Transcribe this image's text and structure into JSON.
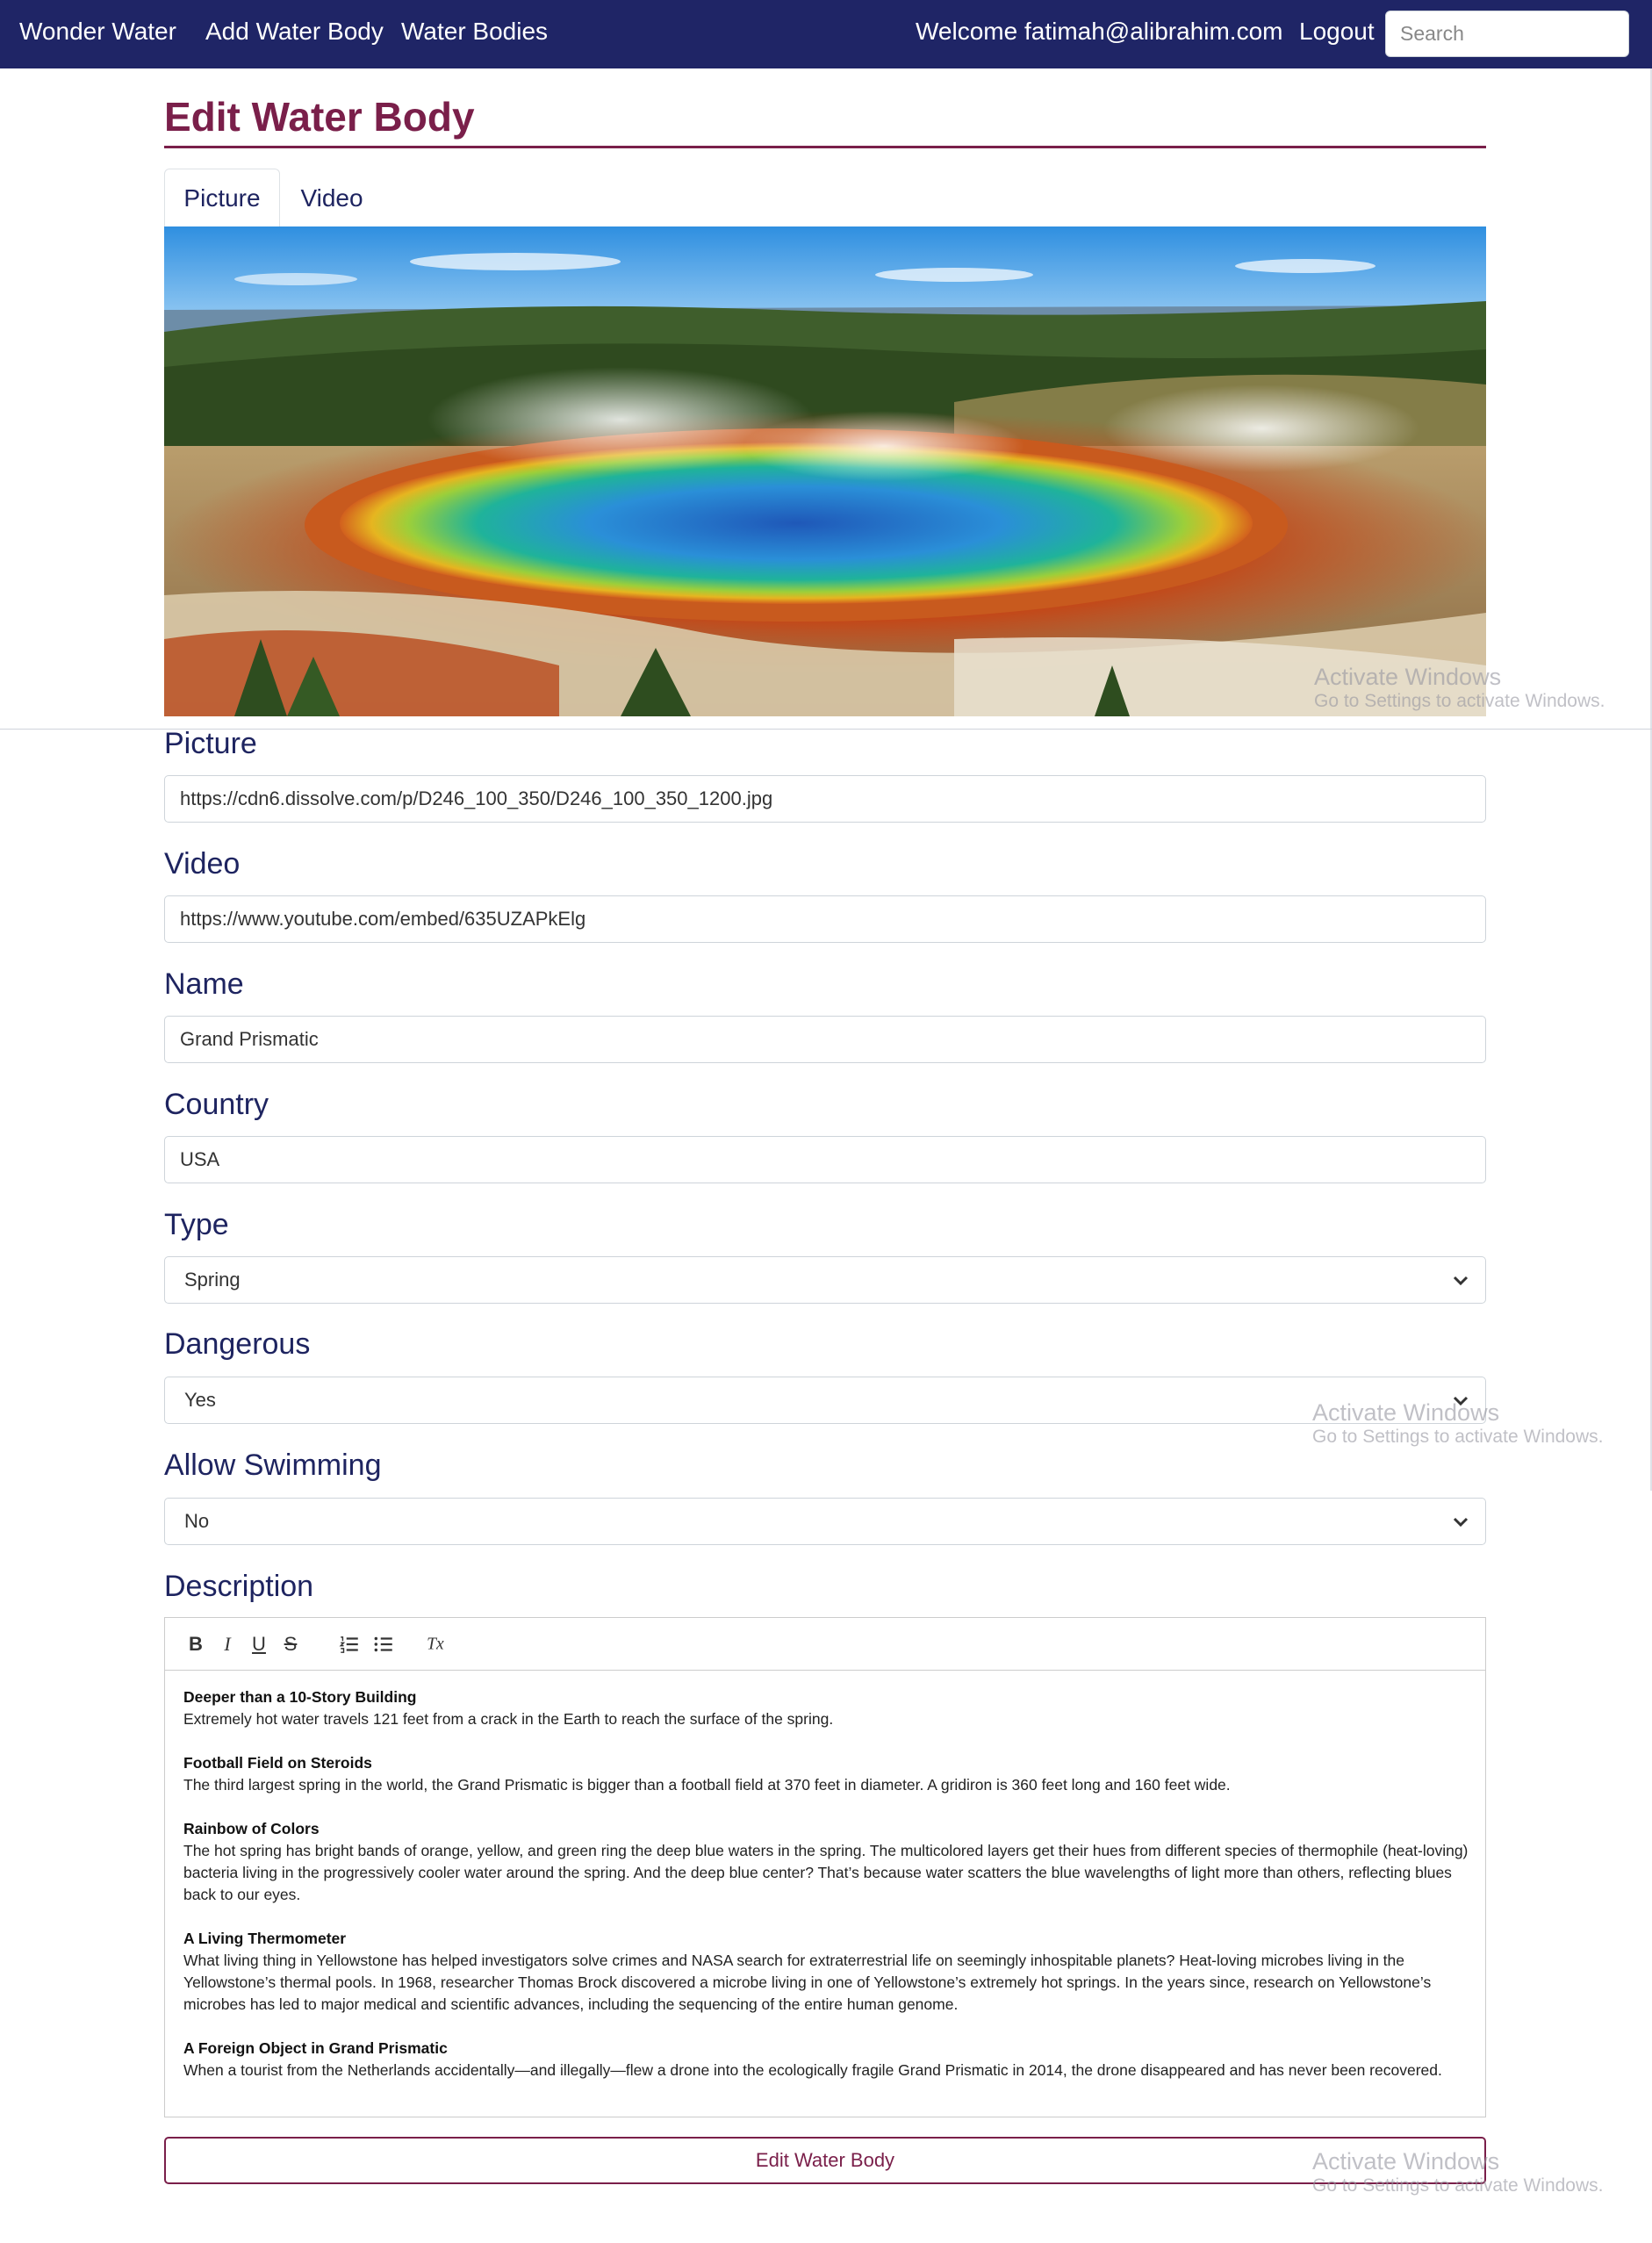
{
  "navbar": {
    "brand": "Wonder Water",
    "add_link": "Add Water Body",
    "list_link": "Water Bodies",
    "welcome": "Welcome fatimah@alibrahim.com",
    "logout": "Logout",
    "search_placeholder": "Search"
  },
  "page": {
    "title": "Edit Water Body"
  },
  "tabs": [
    {
      "label": "Picture",
      "active": true
    },
    {
      "label": "Video",
      "active": false
    }
  ],
  "form": {
    "picture": {
      "label": "Picture",
      "value": "https://cdn6.dissolve.com/p/D246_100_350/D246_100_350_1200.jpg"
    },
    "video": {
      "label": "Video",
      "value": "https://www.youtube.com/embed/635UZAPkElg"
    },
    "name": {
      "label": "Name",
      "value": "Grand Prismatic"
    },
    "country": {
      "label": "Country",
      "value": "USA"
    },
    "type": {
      "label": "Type",
      "value": "Spring"
    },
    "dangerous": {
      "label": "Dangerous",
      "value": "Yes"
    },
    "allow_swimming": {
      "label": "Allow Swimming",
      "value": "No"
    },
    "description": {
      "label": "Description",
      "toolbar": {
        "bold": "B",
        "italic": "I",
        "underline": "U",
        "strike": "S",
        "clear": "Tx"
      },
      "sections": [
        {
          "heading": "Deeper than a 10-Story Building",
          "body": "Extremely hot water travels 121 feet from a crack in the Earth to reach the surface of the spring."
        },
        {
          "heading": "Football Field on Steroids",
          "body": "The third largest spring in the world, the Grand Prismatic is bigger than a football field at 370 feet in diameter. A gridiron is 360 feet long and 160 feet wide."
        },
        {
          "heading": "Rainbow of Colors",
          "body": "The hot spring has bright bands of orange, yellow, and green ring the deep blue waters in the spring. The multicolored layers get their hues from different species of thermophile (heat-loving) bacteria living in the progressively cooler water around the spring. And the deep blue center? That’s because water scatters the blue wavelengths of light more than others, reflecting blues back to our eyes."
        },
        {
          "heading": "A Living Thermometer",
          "body": "What living thing in Yellowstone has helped investigators solve crimes and NASA search for extraterrestrial life on seemingly inhospitable planets? Heat-loving microbes living in the Yellowstone’s thermal pools. In 1968, researcher Thomas Brock discovered a microbe living in one of Yellowstone’s extremely hot springs. In the years since, research on Yellowstone’s microbes has led to major medical and scientific advances, including the sequencing of the entire human genome."
        },
        {
          "heading": "A Foreign Object in Grand Prismatic",
          "body": "When a tourist from the Netherlands accidentally—and illegally—flew a drone into the ecologically fragile Grand Prismatic in 2014, the drone disappeared and has never been recovered."
        }
      ]
    },
    "submit_label": "Edit Water Body"
  },
  "watermarks": [
    {
      "title": "Activate Windows",
      "sub": "Go to Settings to activate Windows."
    },
    {
      "title": "Activate Windows",
      "sub": "Go to Settings to activate Windows."
    },
    {
      "title": "Activate Windows",
      "sub": "Go to Settings to activate Windows."
    }
  ],
  "colors": {
    "navbar": "#1f2566",
    "accent": "#7a1f4a",
    "label": "#1e2460"
  }
}
